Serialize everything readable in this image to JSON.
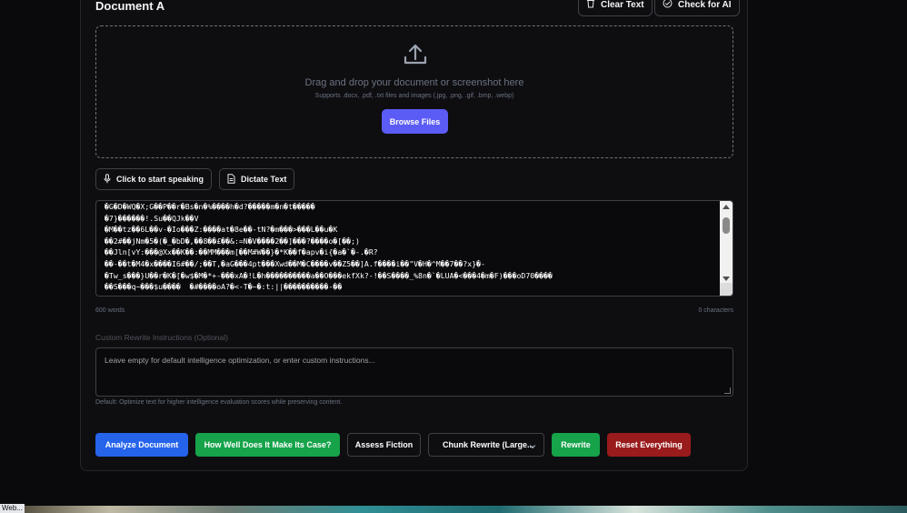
{
  "document": {
    "title": "Document A",
    "clear_text_label": "Clear Text",
    "check_ai_label": "Check for AI"
  },
  "dropzone": {
    "main_text": "Drag and drop your document or screenshot here",
    "sub_text": "Supports .docx, .pdf, .txt files and images (.jpg, .png, .gif, .bmp, .webp)",
    "browse_label": "Browse Files"
  },
  "voice": {
    "speak_label": "Click to start speaking",
    "dictate_label": "Dictate Text"
  },
  "textarea": {
    "content": "�G�D�WQ�X;G��P��r�Bs�n�%����h�d?�����m�n�t�����\n�7}������!.Su��QJk��V\n�M��tz��6L��v-�Io���Z:����at�8e��-tN?�m���>���L��u�K\n��2#��jNm�5�(�_�bD�,��8��£��&:=N�V����2��]���?����o�[��;)\n��Jln[vY:���@Xx��K��:��MM���m[��M#W��}�*K��f�apv�i{�a�`�-.�R?\n��-��t�M4�x����I6#��/;��T,�aG���4pt���Xwd��M�C����v��Z5��]A.f����i��\"V�H�^M��7��?x}�-\n�Tw_s���}U��r�K�[�w$�M�*+-���xA�!L�h����������a��O���ekfXk?-!��S����_%8n�`�LUA�<���4�m�F)���oD70����\n��S���q~���$u����  �#����oA?�<-T�~�:t:||����������-��"
  },
  "counts": {
    "words": "600 words",
    "characters": "0 characters"
  },
  "custom": {
    "label": "Custom Rewrite Instructions (Optional)",
    "placeholder": "Leave empty for default intelligence optimization, or enter custom instructions...",
    "default_note": "Default: Optimize text for higher intelligence evaluation scores while preserving content."
  },
  "actions": {
    "analyze": "Analyze Document",
    "case": "How Well Does It Make Its Case?",
    "fiction": "Assess Fiction",
    "chunk": "Chunk Rewrite (Large...",
    "rewrite": "Rewrite",
    "reset": "Reset Everything"
  },
  "taskbar": {
    "label": "Web..."
  },
  "colors": {
    "accent_indigo": "#5b5bf5",
    "analyze_blue": "#2563eb",
    "green": "#16a34a",
    "reset_red": "#991b1b"
  },
  "icons": [
    "trash-icon",
    "check-circle-icon",
    "upload-icon",
    "microphone-icon",
    "file-icon",
    "chevron-down-icon"
  ]
}
